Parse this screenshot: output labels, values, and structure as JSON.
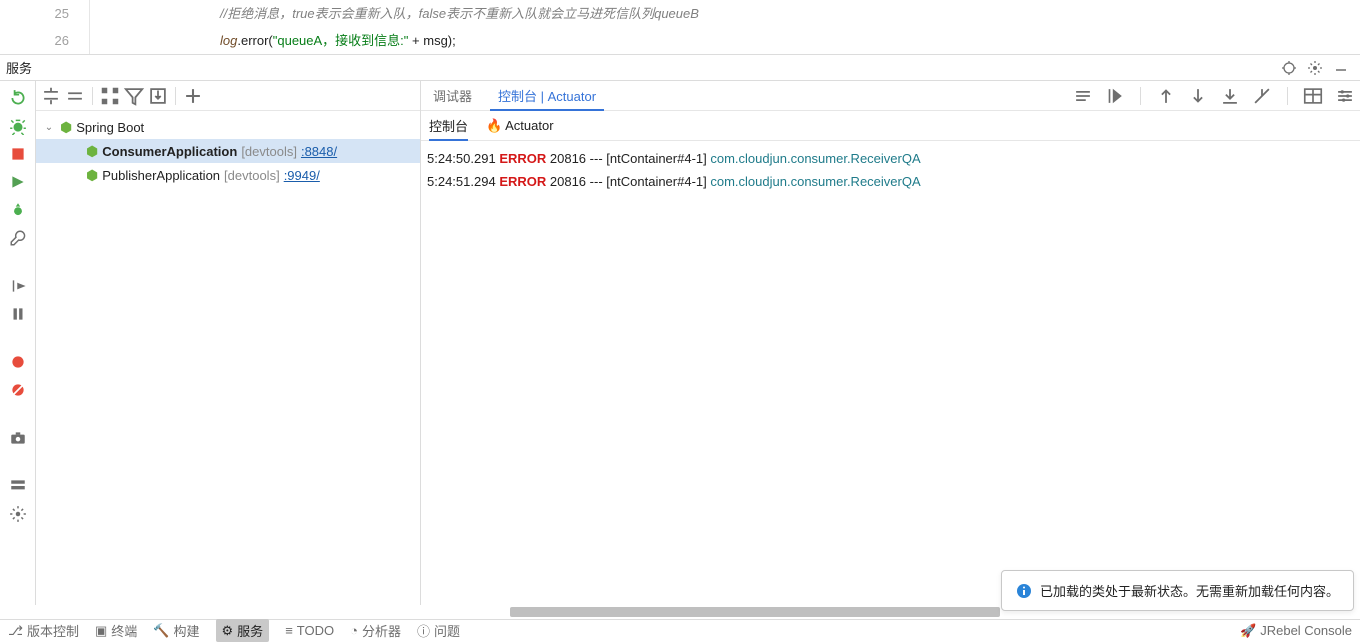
{
  "editor": {
    "lines": [
      "25",
      "26"
    ],
    "line25_comment": "//拒绝消息，true表示会重新入队，false表示不重新入队就会立马进死信队列queueB",
    "line26_prefix": "log",
    "line26_method": ".error(",
    "line26_str": "\"queueA，接收到信息:\"",
    "line26_rest": " + msg);"
  },
  "services_title": "服务",
  "tree": {
    "root": "Spring Boot",
    "apps": [
      {
        "name": "ConsumerApplication",
        "devtools": "[devtools]",
        "port": ":8848/",
        "bold": true
      },
      {
        "name": "PublisherApplication",
        "devtools": "[devtools]",
        "port": ":9949/",
        "bold": false
      }
    ]
  },
  "tabs": {
    "debugger": "调试器",
    "console_actuator": "控制台 | Actuator",
    "sub_console": "控制台",
    "sub_actuator": "Actuator"
  },
  "log_rows": [
    {
      "time": "5:24:50.291",
      "level": "ERROR",
      "pid": "20816",
      "dash": "---",
      "thread": "[ntContainer#4-1]",
      "cls": "com.cloudjun.consumer.ReceiverQA"
    },
    {
      "time": "5:24:51.294",
      "level": "ERROR",
      "pid": "20816",
      "dash": "---",
      "thread": "[ntContainer#4-1]",
      "cls": "com.cloudjun.consumer.ReceiverQA"
    }
  ],
  "notif": "已加载的类处于最新状态。无需重新加载任何内容。",
  "status": {
    "vcs": "版本控制",
    "term": "终端",
    "build": "构建",
    "services": "服务",
    "todo": "TODO",
    "profiler": "分析器",
    "problems": "问题",
    "jrebel": "JRebel Console"
  }
}
